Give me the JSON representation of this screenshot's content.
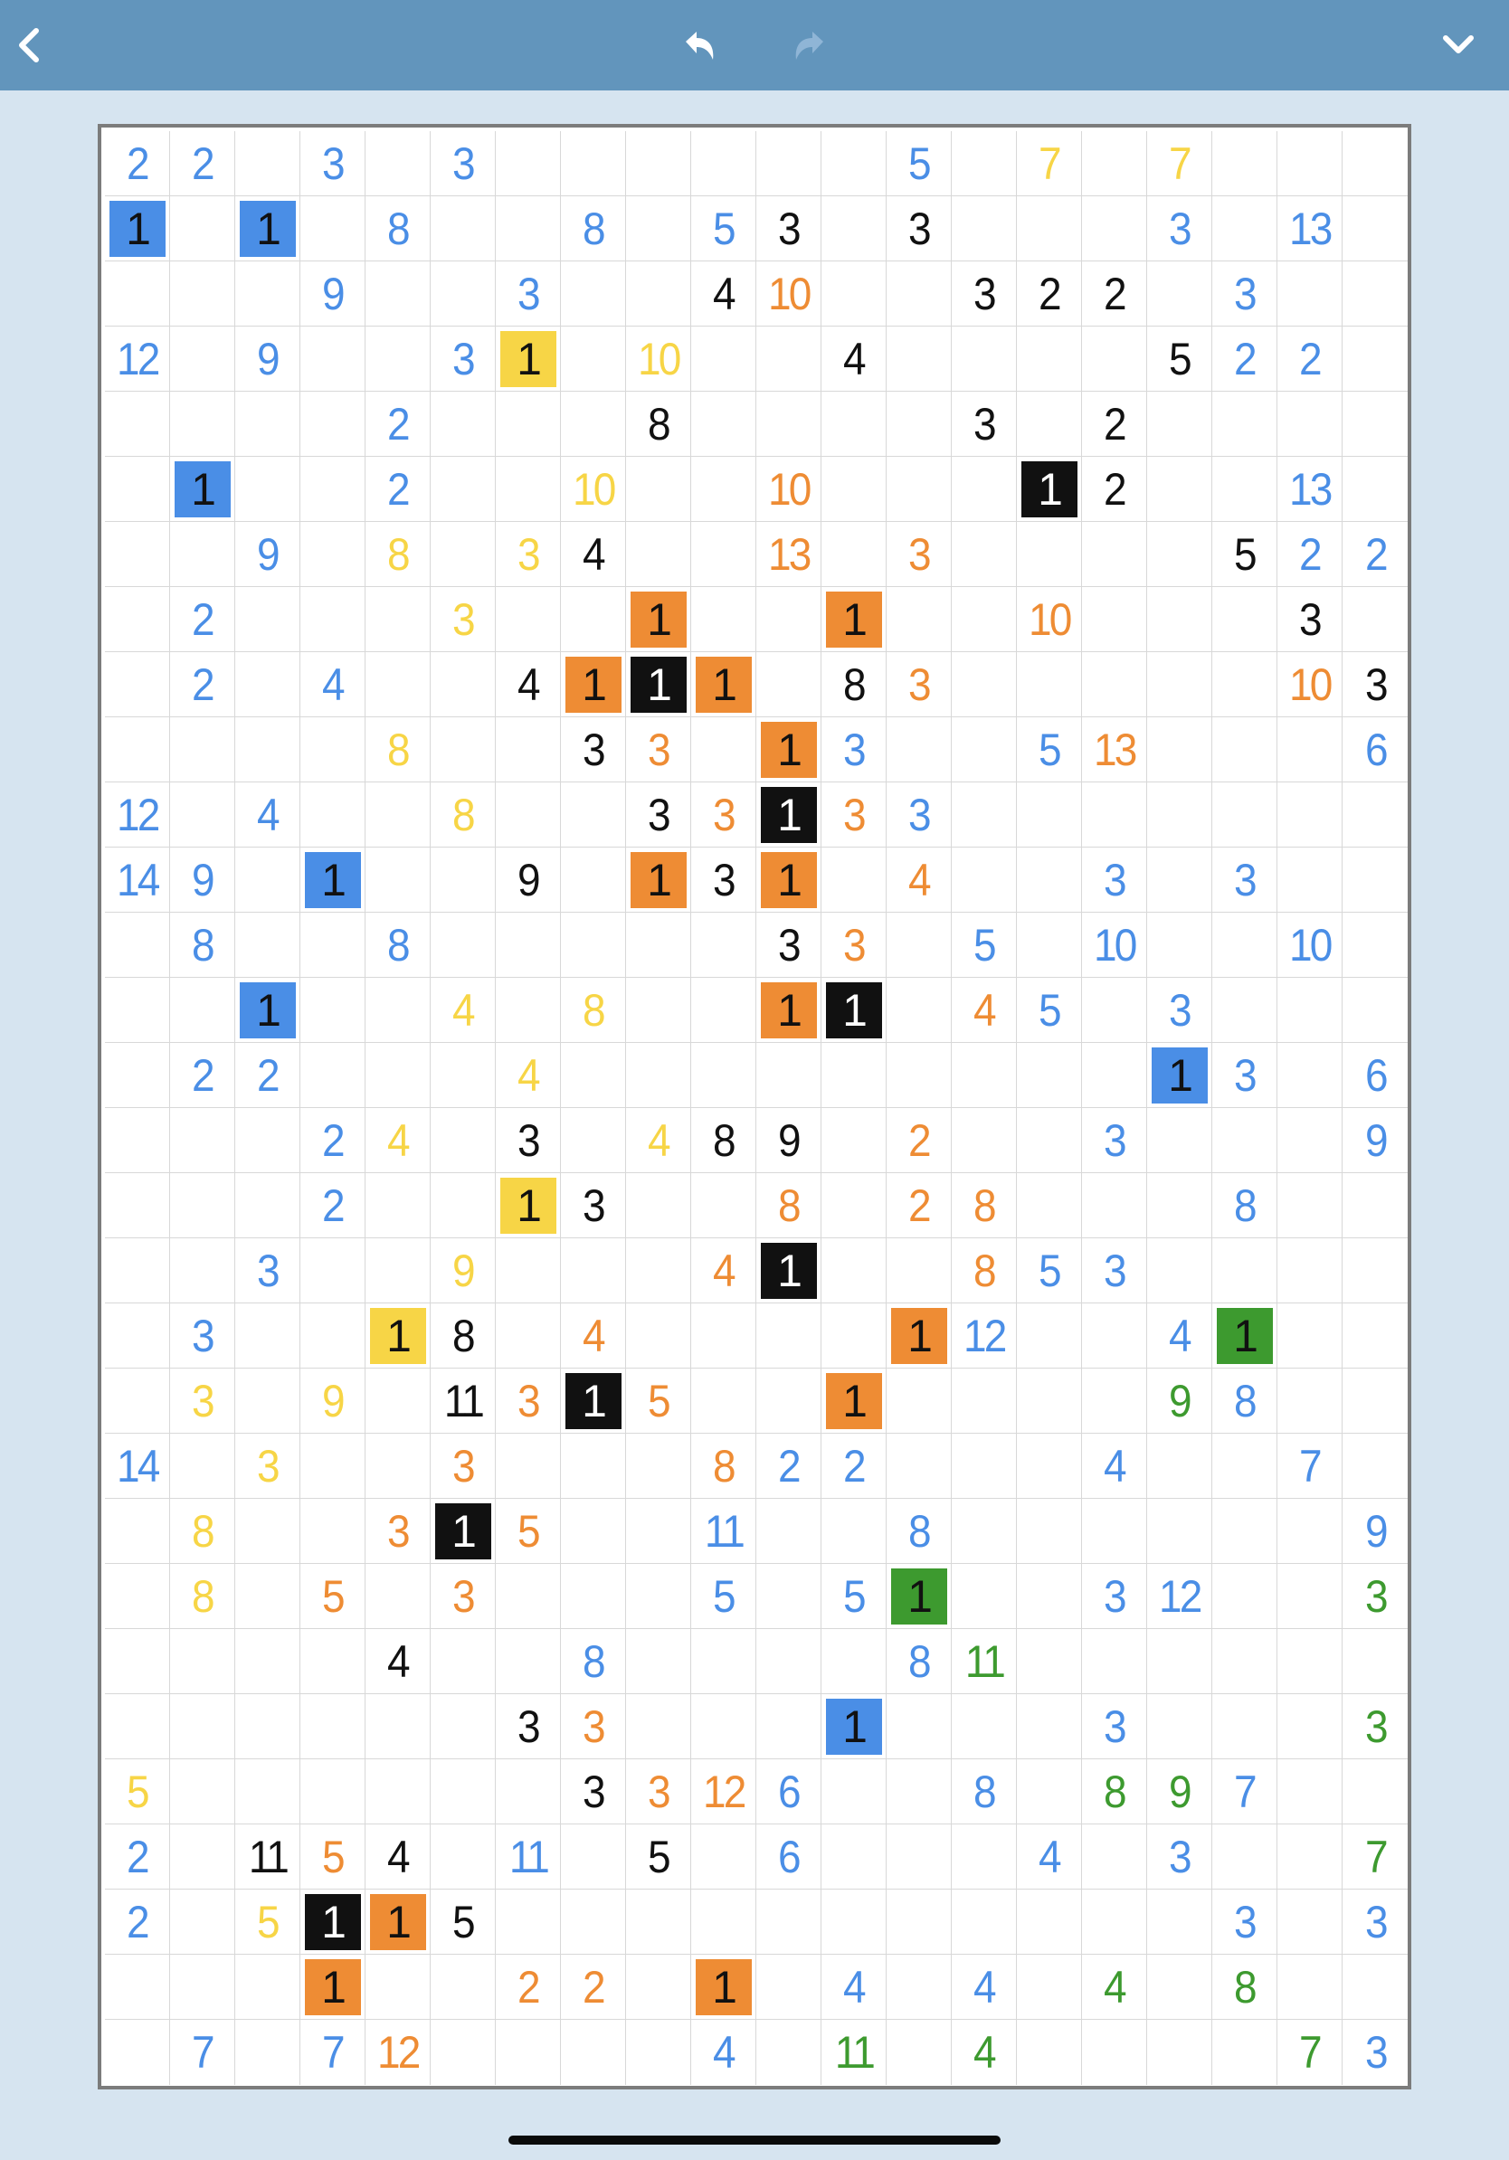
{
  "toolbar": {
    "back_icon": "chevron-left-icon",
    "undo_icon": "undo-icon",
    "redo_icon": "redo-icon",
    "menu_icon": "chevron-down-icon"
  },
  "colors": {
    "topbar": "#6295bc",
    "background": "#d6e4f0",
    "k": "#111111",
    "b": "#4a8ee6",
    "y": "#f7d546",
    "o": "#ee8c34",
    "g": "#3d9a2f"
  },
  "puzzle": {
    "columns": 20,
    "rows": 30,
    "cells": [
      [
        0,
        0,
        "2",
        "b",
        0
      ],
      [
        0,
        1,
        "2",
        "b",
        0
      ],
      [
        0,
        3,
        "3",
        "b",
        0
      ],
      [
        0,
        5,
        "3",
        "b",
        0
      ],
      [
        0,
        12,
        "5",
        "b",
        0
      ],
      [
        0,
        14,
        "7",
        "y",
        0
      ],
      [
        0,
        16,
        "7",
        "y",
        0
      ],
      [
        1,
        0,
        "1",
        "b",
        1
      ],
      [
        1,
        2,
        "1",
        "b",
        1
      ],
      [
        1,
        4,
        "8",
        "b",
        0
      ],
      [
        1,
        7,
        "8",
        "b",
        0
      ],
      [
        1,
        9,
        "5",
        "b",
        0
      ],
      [
        1,
        10,
        "3",
        "k",
        0
      ],
      [
        1,
        12,
        "3",
        "k",
        0
      ],
      [
        1,
        16,
        "3",
        "b",
        0
      ],
      [
        1,
        18,
        "13",
        "b",
        0
      ],
      [
        2,
        3,
        "9",
        "b",
        0
      ],
      [
        2,
        6,
        "3",
        "b",
        0
      ],
      [
        2,
        9,
        "4",
        "k",
        0
      ],
      [
        2,
        10,
        "10",
        "o",
        0
      ],
      [
        2,
        13,
        "3",
        "k",
        0
      ],
      [
        2,
        14,
        "2",
        "k",
        0
      ],
      [
        2,
        15,
        "2",
        "k",
        0
      ],
      [
        2,
        17,
        "3",
        "b",
        0
      ],
      [
        3,
        0,
        "12",
        "b",
        0
      ],
      [
        3,
        2,
        "9",
        "b",
        0
      ],
      [
        3,
        5,
        "3",
        "b",
        0
      ],
      [
        3,
        6,
        "1",
        "y",
        1
      ],
      [
        3,
        8,
        "10",
        "y",
        0
      ],
      [
        3,
        11,
        "4",
        "k",
        0
      ],
      [
        3,
        16,
        "5",
        "k",
        0
      ],
      [
        3,
        17,
        "2",
        "b",
        0
      ],
      [
        3,
        18,
        "2",
        "b",
        0
      ],
      [
        4,
        4,
        "2",
        "b",
        0
      ],
      [
        4,
        8,
        "8",
        "k",
        0
      ],
      [
        4,
        13,
        "3",
        "k",
        0
      ],
      [
        4,
        15,
        "2",
        "k",
        0
      ],
      [
        5,
        1,
        "1",
        "b",
        1
      ],
      [
        5,
        4,
        "2",
        "b",
        0
      ],
      [
        5,
        7,
        "10",
        "y",
        0
      ],
      [
        5,
        10,
        "10",
        "o",
        0
      ],
      [
        5,
        14,
        "1",
        "k",
        1
      ],
      [
        5,
        15,
        "2",
        "k",
        0
      ],
      [
        5,
        18,
        "13",
        "b",
        0
      ],
      [
        6,
        2,
        "9",
        "b",
        0
      ],
      [
        6,
        4,
        "8",
        "y",
        0
      ],
      [
        6,
        6,
        "3",
        "y",
        0
      ],
      [
        6,
        7,
        "4",
        "k",
        0
      ],
      [
        6,
        10,
        "13",
        "o",
        0
      ],
      [
        6,
        12,
        "3",
        "o",
        0
      ],
      [
        6,
        17,
        "5",
        "k",
        0
      ],
      [
        6,
        18,
        "2",
        "b",
        0
      ],
      [
        6,
        19,
        "2",
        "b",
        0
      ],
      [
        7,
        1,
        "2",
        "b",
        0
      ],
      [
        7,
        5,
        "3",
        "y",
        0
      ],
      [
        7,
        8,
        "1",
        "o",
        1
      ],
      [
        7,
        11,
        "1",
        "o",
        1
      ],
      [
        7,
        14,
        "10",
        "o",
        0
      ],
      [
        7,
        18,
        "3",
        "k",
        0
      ],
      [
        8,
        1,
        "2",
        "b",
        0
      ],
      [
        8,
        3,
        "4",
        "b",
        0
      ],
      [
        8,
        6,
        "4",
        "k",
        0
      ],
      [
        8,
        7,
        "1",
        "o",
        1
      ],
      [
        8,
        8,
        "1",
        "k",
        1
      ],
      [
        8,
        9,
        "1",
        "o",
        1
      ],
      [
        8,
        11,
        "8",
        "k",
        0
      ],
      [
        8,
        12,
        "3",
        "o",
        0
      ],
      [
        8,
        18,
        "10",
        "o",
        0
      ],
      [
        8,
        19,
        "3",
        "k",
        0
      ],
      [
        9,
        4,
        "8",
        "y",
        0
      ],
      [
        9,
        7,
        "3",
        "k",
        0
      ],
      [
        9,
        8,
        "3",
        "o",
        0
      ],
      [
        9,
        10,
        "1",
        "o",
        1
      ],
      [
        9,
        11,
        "3",
        "b",
        0
      ],
      [
        9,
        14,
        "5",
        "b",
        0
      ],
      [
        9,
        15,
        "13",
        "o",
        0
      ],
      [
        9,
        19,
        "6",
        "b",
        0
      ],
      [
        10,
        0,
        "12",
        "b",
        0
      ],
      [
        10,
        2,
        "4",
        "b",
        0
      ],
      [
        10,
        5,
        "8",
        "y",
        0
      ],
      [
        10,
        8,
        "3",
        "k",
        0
      ],
      [
        10,
        9,
        "3",
        "o",
        0
      ],
      [
        10,
        10,
        "1",
        "k",
        1
      ],
      [
        10,
        11,
        "3",
        "o",
        0
      ],
      [
        10,
        12,
        "3",
        "b",
        0
      ],
      [
        11,
        0,
        "14",
        "b",
        0
      ],
      [
        11,
        1,
        "9",
        "b",
        0
      ],
      [
        11,
        3,
        "1",
        "b",
        1
      ],
      [
        11,
        6,
        "9",
        "k",
        0
      ],
      [
        11,
        8,
        "1",
        "o",
        1
      ],
      [
        11,
        9,
        "3",
        "k",
        0
      ],
      [
        11,
        10,
        "1",
        "o",
        1
      ],
      [
        11,
        12,
        "4",
        "o",
        0
      ],
      [
        11,
        15,
        "3",
        "b",
        0
      ],
      [
        11,
        17,
        "3",
        "b",
        0
      ],
      [
        12,
        1,
        "8",
        "b",
        0
      ],
      [
        12,
        4,
        "8",
        "b",
        0
      ],
      [
        12,
        10,
        "3",
        "k",
        0
      ],
      [
        12,
        11,
        "3",
        "o",
        0
      ],
      [
        12,
        13,
        "5",
        "b",
        0
      ],
      [
        12,
        15,
        "10",
        "b",
        0
      ],
      [
        12,
        18,
        "10",
        "b",
        0
      ],
      [
        13,
        2,
        "1",
        "b",
        1
      ],
      [
        13,
        5,
        "4",
        "y",
        0
      ],
      [
        13,
        7,
        "8",
        "y",
        0
      ],
      [
        13,
        10,
        "1",
        "o",
        1
      ],
      [
        13,
        11,
        "1",
        "k",
        1
      ],
      [
        13,
        13,
        "4",
        "o",
        0
      ],
      [
        13,
        14,
        "5",
        "b",
        0
      ],
      [
        13,
        16,
        "3",
        "b",
        0
      ],
      [
        14,
        1,
        "2",
        "b",
        0
      ],
      [
        14,
        2,
        "2",
        "b",
        0
      ],
      [
        14,
        6,
        "4",
        "y",
        0
      ],
      [
        14,
        16,
        "1",
        "b",
        1
      ],
      [
        14,
        17,
        "3",
        "b",
        0
      ],
      [
        14,
        19,
        "6",
        "b",
        0
      ],
      [
        15,
        3,
        "2",
        "b",
        0
      ],
      [
        15,
        4,
        "4",
        "y",
        0
      ],
      [
        15,
        6,
        "3",
        "k",
        0
      ],
      [
        15,
        8,
        "4",
        "y",
        0
      ],
      [
        15,
        9,
        "8",
        "k",
        0
      ],
      [
        15,
        10,
        "9",
        "k",
        0
      ],
      [
        15,
        12,
        "2",
        "o",
        0
      ],
      [
        15,
        15,
        "3",
        "b",
        0
      ],
      [
        15,
        19,
        "9",
        "b",
        0
      ],
      [
        16,
        3,
        "2",
        "b",
        0
      ],
      [
        16,
        6,
        "1",
        "y",
        1
      ],
      [
        16,
        7,
        "3",
        "k",
        0
      ],
      [
        16,
        10,
        "8",
        "o",
        0
      ],
      [
        16,
        12,
        "2",
        "o",
        0
      ],
      [
        16,
        13,
        "8",
        "o",
        0
      ],
      [
        16,
        17,
        "8",
        "b",
        0
      ],
      [
        17,
        2,
        "3",
        "b",
        0
      ],
      [
        17,
        5,
        "9",
        "y",
        0
      ],
      [
        17,
        9,
        "4",
        "o",
        0
      ],
      [
        17,
        10,
        "1",
        "k",
        1
      ],
      [
        17,
        13,
        "8",
        "o",
        0
      ],
      [
        17,
        14,
        "5",
        "b",
        0
      ],
      [
        17,
        15,
        "3",
        "b",
        0
      ],
      [
        18,
        1,
        "3",
        "b",
        0
      ],
      [
        18,
        4,
        "1",
        "y",
        1
      ],
      [
        18,
        5,
        "8",
        "k",
        0
      ],
      [
        18,
        7,
        "4",
        "o",
        0
      ],
      [
        18,
        12,
        "1",
        "o",
        1
      ],
      [
        18,
        13,
        "12",
        "b",
        0
      ],
      [
        18,
        16,
        "4",
        "b",
        0
      ],
      [
        18,
        17,
        "1",
        "g",
        1
      ],
      [
        19,
        1,
        "3",
        "y",
        0
      ],
      [
        19,
        3,
        "9",
        "y",
        0
      ],
      [
        19,
        5,
        "11",
        "k",
        0
      ],
      [
        19,
        6,
        "3",
        "o",
        0
      ],
      [
        19,
        7,
        "1",
        "k",
        1
      ],
      [
        19,
        8,
        "5",
        "o",
        0
      ],
      [
        19,
        11,
        "1",
        "o",
        1
      ],
      [
        19,
        16,
        "9",
        "g",
        0
      ],
      [
        19,
        17,
        "8",
        "b",
        0
      ],
      [
        20,
        0,
        "14",
        "b",
        0
      ],
      [
        20,
        2,
        "3",
        "y",
        0
      ],
      [
        20,
        5,
        "3",
        "o",
        0
      ],
      [
        20,
        9,
        "8",
        "o",
        0
      ],
      [
        20,
        10,
        "2",
        "b",
        0
      ],
      [
        20,
        11,
        "2",
        "b",
        0
      ],
      [
        20,
        15,
        "4",
        "b",
        0
      ],
      [
        20,
        18,
        "7",
        "b",
        0
      ],
      [
        21,
        1,
        "8",
        "y",
        0
      ],
      [
        21,
        4,
        "3",
        "o",
        0
      ],
      [
        21,
        5,
        "1",
        "k",
        1
      ],
      [
        21,
        6,
        "5",
        "o",
        0
      ],
      [
        21,
        9,
        "11",
        "b",
        0
      ],
      [
        21,
        12,
        "8",
        "b",
        0
      ],
      [
        21,
        19,
        "9",
        "b",
        0
      ],
      [
        22,
        1,
        "8",
        "y",
        0
      ],
      [
        22,
        3,
        "5",
        "o",
        0
      ],
      [
        22,
        5,
        "3",
        "o",
        0
      ],
      [
        22,
        9,
        "5",
        "b",
        0
      ],
      [
        22,
        11,
        "5",
        "b",
        0
      ],
      [
        22,
        12,
        "1",
        "g",
        1
      ],
      [
        22,
        15,
        "3",
        "b",
        0
      ],
      [
        22,
        16,
        "12",
        "b",
        0
      ],
      [
        22,
        19,
        "3",
        "g",
        0
      ],
      [
        23,
        4,
        "4",
        "k",
        0
      ],
      [
        23,
        7,
        "8",
        "b",
        0
      ],
      [
        23,
        12,
        "8",
        "b",
        0
      ],
      [
        23,
        13,
        "11",
        "g",
        0
      ],
      [
        24,
        6,
        "3",
        "k",
        0
      ],
      [
        24,
        7,
        "3",
        "o",
        0
      ],
      [
        24,
        11,
        "1",
        "b",
        1
      ],
      [
        24,
        15,
        "3",
        "b",
        0
      ],
      [
        24,
        19,
        "3",
        "g",
        0
      ],
      [
        25,
        0,
        "5",
        "y",
        0
      ],
      [
        25,
        7,
        "3",
        "k",
        0
      ],
      [
        25,
        8,
        "3",
        "o",
        0
      ],
      [
        25,
        9,
        "12",
        "o",
        0
      ],
      [
        25,
        10,
        "6",
        "b",
        0
      ],
      [
        25,
        13,
        "8",
        "b",
        0
      ],
      [
        25,
        15,
        "8",
        "g",
        0
      ],
      [
        25,
        16,
        "9",
        "g",
        0
      ],
      [
        25,
        17,
        "7",
        "b",
        0
      ],
      [
        26,
        0,
        "2",
        "b",
        0
      ],
      [
        26,
        2,
        "11",
        "k",
        0
      ],
      [
        26,
        3,
        "5",
        "o",
        0
      ],
      [
        26,
        4,
        "4",
        "k",
        0
      ],
      [
        26,
        6,
        "11",
        "b",
        0
      ],
      [
        26,
        8,
        "5",
        "k",
        0
      ],
      [
        26,
        10,
        "6",
        "b",
        0
      ],
      [
        26,
        14,
        "4",
        "b",
        0
      ],
      [
        26,
        16,
        "3",
        "b",
        0
      ],
      [
        26,
        19,
        "7",
        "g",
        0
      ],
      [
        27,
        0,
        "2",
        "b",
        0
      ],
      [
        27,
        2,
        "5",
        "y",
        0
      ],
      [
        27,
        3,
        "1",
        "k",
        1
      ],
      [
        27,
        4,
        "1",
        "o",
        1
      ],
      [
        27,
        5,
        "5",
        "k",
        0
      ],
      [
        27,
        17,
        "3",
        "b",
        0
      ],
      [
        27,
        19,
        "3",
        "b",
        0
      ],
      [
        28,
        3,
        "1",
        "o",
        1
      ],
      [
        28,
        6,
        "2",
        "o",
        0
      ],
      [
        28,
        7,
        "2",
        "o",
        0
      ],
      [
        28,
        9,
        "1",
        "o",
        1
      ],
      [
        28,
        11,
        "4",
        "b",
        0
      ],
      [
        28,
        13,
        "4",
        "b",
        0
      ],
      [
        28,
        15,
        "4",
        "g",
        0
      ],
      [
        28,
        17,
        "8",
        "g",
        0
      ],
      [
        29,
        1,
        "7",
        "b",
        0
      ],
      [
        29,
        3,
        "7",
        "b",
        0
      ],
      [
        29,
        4,
        "12",
        "o",
        0
      ],
      [
        29,
        9,
        "4",
        "b",
        0
      ],
      [
        29,
        11,
        "11",
        "g",
        0
      ],
      [
        29,
        13,
        "4",
        "g",
        0
      ],
      [
        29,
        18,
        "7",
        "g",
        0
      ],
      [
        29,
        19,
        "3",
        "b",
        0
      ]
    ]
  }
}
